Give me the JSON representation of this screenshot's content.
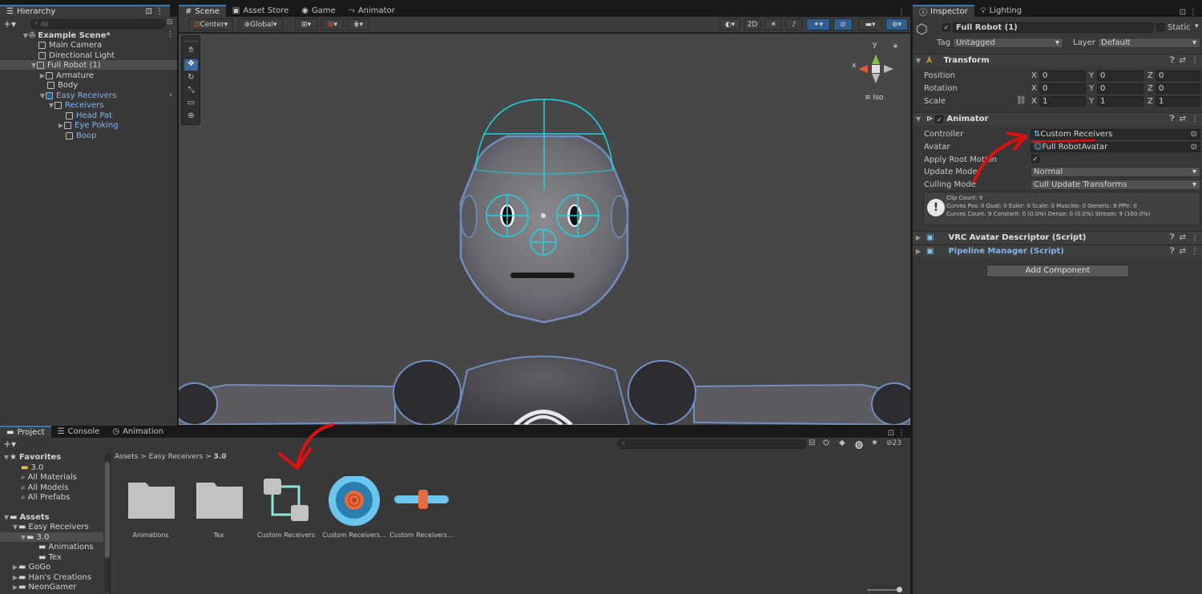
{
  "hierarchy": {
    "tab_label": "Hierarchy",
    "search_placeholder": "All",
    "items": [
      {
        "label": "Example Scene*"
      },
      {
        "label": "Main Camera"
      },
      {
        "label": "Directional Light"
      },
      {
        "label": "Full Robot (1)"
      },
      {
        "label": "Armature"
      },
      {
        "label": "Body"
      },
      {
        "label": "Easy Receivers"
      },
      {
        "label": "Receivers"
      },
      {
        "label": "Head Pat"
      },
      {
        "label": "Eye Poking"
      },
      {
        "label": "Boop"
      }
    ]
  },
  "scene": {
    "tabs": [
      {
        "label": "Scene"
      },
      {
        "label": "Asset Store"
      },
      {
        "label": "Game"
      },
      {
        "label": "Animator"
      }
    ],
    "toolbar": {
      "pivot": "Center",
      "space": "Global",
      "mode_2d": "2D"
    },
    "gizmo": {
      "x": "x",
      "y": "y",
      "projection": "Iso"
    }
  },
  "inspector": {
    "tabs": [
      {
        "label": "Inspector"
      },
      {
        "label": "Lighting"
      }
    ],
    "object_name": "Full Robot (1)",
    "static_label": "Static",
    "tag_label": "Tag",
    "tag_value": "Untagged",
    "layer_label": "Layer",
    "layer_value": "Default",
    "transform": {
      "title": "Transform",
      "position_label": "Position",
      "rotation_label": "Rotation",
      "scale_label": "Scale",
      "axis_x": "X",
      "axis_y": "Y",
      "axis_z": "Z",
      "position": [
        "0",
        "0",
        "0"
      ],
      "rotation": [
        "0",
        "0",
        "0"
      ],
      "scale": [
        "1",
        "1",
        "1"
      ]
    },
    "animator": {
      "title": "Animator",
      "controller_label": "Controller",
      "controller_value": "Custom Receivers",
      "avatar_label": "Avatar",
      "avatar_value": "Full RobotAvatar",
      "apply_root_motion_label": "Apply Root Motion",
      "update_mode_label": "Update Mode",
      "update_mode_value": "Normal",
      "culling_mode_label": "Culling Mode",
      "culling_mode_value": "Cull Update Transforms",
      "info_line1": "Clip Count: 9",
      "info_line2": "Curves Pos: 0 Quat: 0 Euler: 0 Scale: 0 Muscles: 0 Generic: 9 PPtr: 0",
      "info_line3": "Curves Count: 9 Constant: 0 (0.0%) Dense: 0 (0.0%) Stream: 9 (100.0%)"
    },
    "vrc_descriptor": "VRC Avatar Descriptor (Script)",
    "pipeline_manager": "Pipeline Manager (Script)",
    "add_component": "Add Component"
  },
  "project": {
    "tabs": [
      {
        "label": "Project"
      },
      {
        "label": "Console"
      },
      {
        "label": "Animation"
      }
    ],
    "hidden_count": "23",
    "breadcrumb": [
      "Assets",
      "Easy Receivers",
      "3.0"
    ],
    "favorites_label": "Favorites",
    "favorites": [
      "3.0",
      "All Materials",
      "All Models",
      "All Prefabs"
    ],
    "assets_label": "Assets",
    "tree": [
      "Easy Receivers",
      "3.0",
      "Animations",
      "Tex",
      "GoGo",
      "Han's Creations",
      "NeonGamer"
    ],
    "grid_items": [
      {
        "label": "Animations"
      },
      {
        "label": "Tex"
      },
      {
        "label": "Custom Receivers"
      },
      {
        "label": "Custom Receivers..."
      },
      {
        "label": "Custom Receivers..."
      }
    ]
  },
  "colors": {
    "accent_blue": "#3a79bb",
    "annotation_red": "#e01010",
    "gizmo_cyan": "#1ad6e6"
  }
}
